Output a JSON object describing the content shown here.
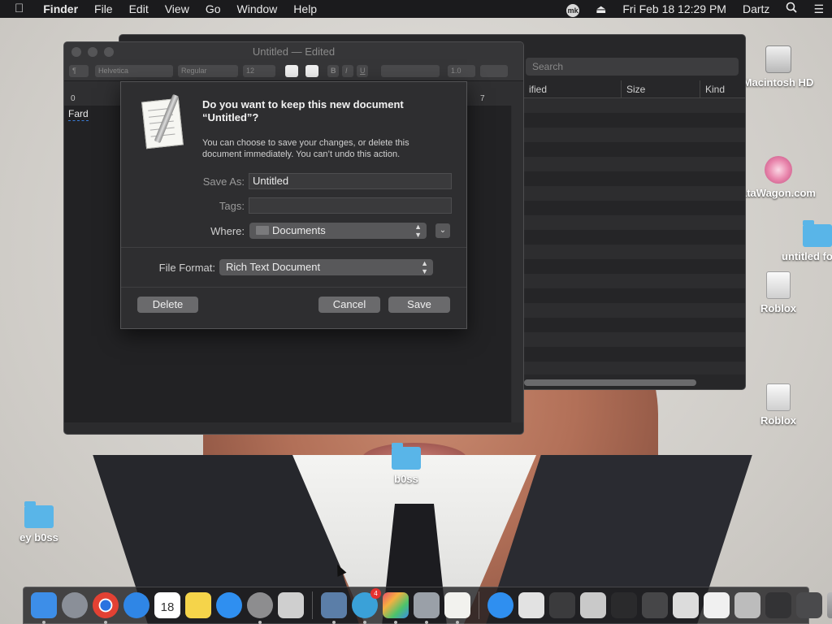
{
  "menubar": {
    "app_name": "Finder",
    "menus": [
      "File",
      "Edit",
      "View",
      "Go",
      "Window",
      "Help"
    ],
    "status_badge": "mk",
    "clock": "Fri Feb 18  12:29 PM",
    "user": "Dartz"
  },
  "desktop": {
    "icons": [
      {
        "label": "Macintosh HD",
        "kind": "hard-drive"
      },
      {
        "label": "ataWagon.com",
        "kind": "webloc"
      },
      {
        "label": "untitled fo",
        "kind": "folder"
      },
      {
        "label": "Roblox",
        "kind": "drive"
      },
      {
        "label": "Roblox",
        "kind": "drive"
      },
      {
        "label": "b0ss",
        "kind": "folder"
      },
      {
        "label": "ey b0ss",
        "kind": "folder"
      }
    ]
  },
  "finder": {
    "search_placeholder": "Search",
    "columns": [
      "ified",
      "Size",
      "Kind"
    ]
  },
  "textedit": {
    "title": "Untitled — Edited",
    "toolbar": {
      "paragraph": "¶",
      "font": "Helvetica",
      "style": "Regular",
      "size": "12",
      "bold": "B",
      "italic": "I",
      "underline": "U",
      "spacing": "1.0"
    },
    "ruler": {
      "start": "0",
      "end": "7"
    },
    "document_text": "Fard"
  },
  "save_dialog": {
    "heading": "Do you want to keep this new document “Untitled”?",
    "description": "You can choose to save your changes, or delete this document immediately. You can’t undo this action.",
    "save_as_label": "Save As:",
    "save_as_value": "Untitled",
    "tags_label": "Tags:",
    "tags_value": "",
    "where_label": "Where:",
    "where_value": "Documents",
    "file_format_label": "File Format:",
    "file_format_value": "Rich Text Document",
    "delete_label": "Delete",
    "cancel_label": "Cancel",
    "save_label": "Save"
  },
  "dock": {
    "apps": [
      {
        "name": "finder-icon",
        "color": "#3d8ee8"
      },
      {
        "name": "launchpad-icon",
        "color": "#8a8f98"
      },
      {
        "name": "chrome-icon",
        "color": "#e9e9e9"
      },
      {
        "name": "safari-icon",
        "color": "#2f86e6"
      },
      {
        "name": "calendar-icon",
        "color": "#ffffff",
        "text": "18"
      },
      {
        "name": "notes-icon",
        "color": "#f5d44a"
      },
      {
        "name": "app-store-icon",
        "color": "#2f8ff0"
      },
      {
        "name": "system-preferences-icon",
        "color": "#8d8d8f"
      },
      {
        "name": "roblox-icon",
        "color": "#cfcfcf"
      },
      {
        "name": "preview-icon",
        "color": "#5b7ea8"
      },
      {
        "name": "mk-app-icon",
        "color": "#3aa1d8",
        "badge": "4"
      },
      {
        "name": "color-picker-icon",
        "color": "#e84e6a"
      },
      {
        "name": "utilities-icon",
        "color": "#9aa0a8"
      },
      {
        "name": "textedit-icon",
        "color": "#f2f2ee"
      },
      {
        "name": "app-store-folder-icon",
        "color": "#2f8ff0"
      },
      {
        "name": "document-thumb-icon",
        "color": "#e2e2e2"
      },
      {
        "name": "window-thumb-icon",
        "color": "#3b3b3d"
      },
      {
        "name": "photo-thumb-icon",
        "color": "#c9c9c9"
      },
      {
        "name": "window-thumb-icon",
        "color": "#2a2a2c"
      },
      {
        "name": "window-thumb-icon",
        "color": "#464648"
      },
      {
        "name": "window-thumb-icon",
        "color": "#dcdcdc"
      },
      {
        "name": "window-thumb-icon",
        "color": "#f0f0f0"
      },
      {
        "name": "window-thumb-icon",
        "color": "#bcbcbc"
      },
      {
        "name": "window-thumb-icon",
        "color": "#333335"
      },
      {
        "name": "window-thumb-icon",
        "color": "#4a4a4c"
      },
      {
        "name": "trash-icon",
        "color": "#9a9a9c"
      }
    ]
  }
}
